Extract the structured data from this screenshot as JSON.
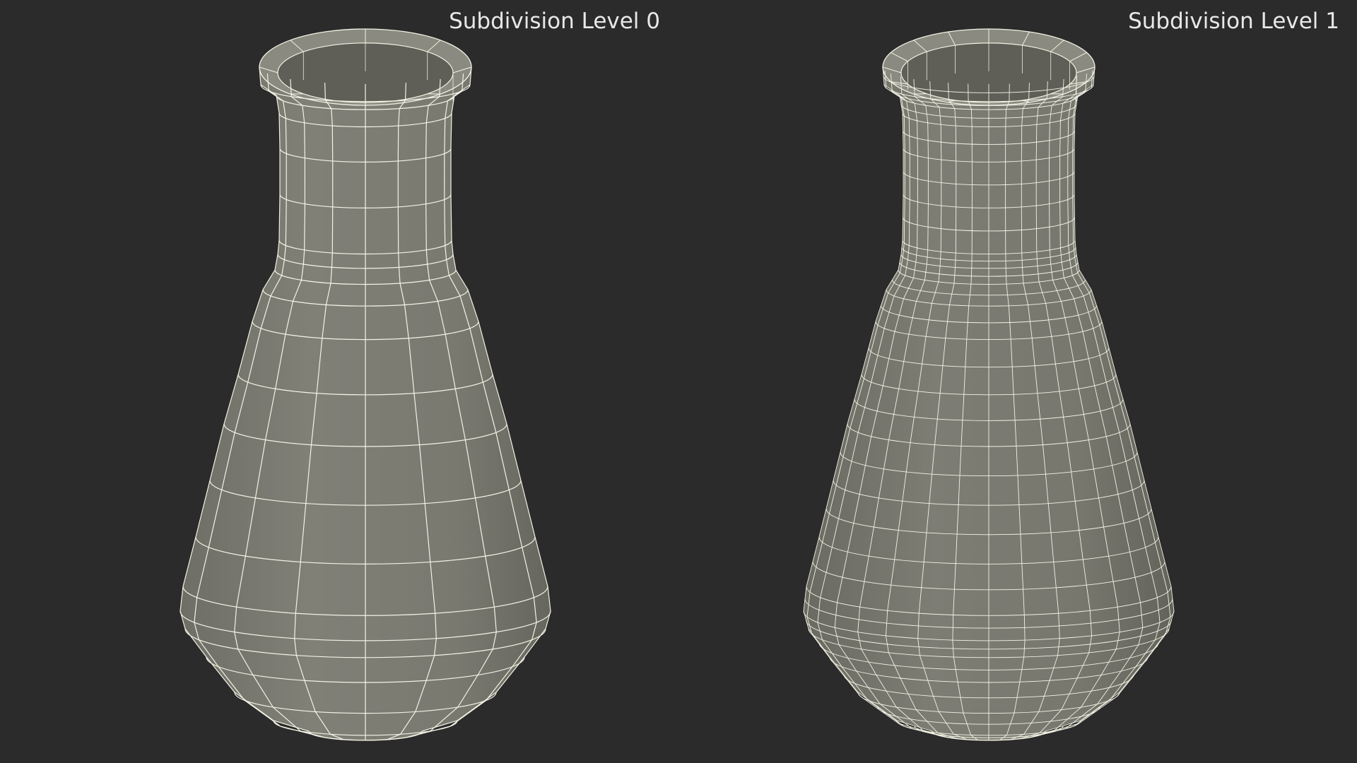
{
  "labels": {
    "left": "Subdivision Level 0",
    "right": "Subdivision Level 1"
  },
  "colors": {
    "background": "#2b2b2b",
    "surface": "#7a7a70",
    "surface_dark": "#5f5f57",
    "surface_light": "#8a8a80",
    "wire": "#f2f2e4",
    "label": "#e8e8e8"
  },
  "models": [
    {
      "name": "flask-level-0",
      "radial_segments": 16,
      "wire_density": 1
    },
    {
      "name": "flask-level-1",
      "radial_segments": 32,
      "wire_density": 2
    }
  ]
}
